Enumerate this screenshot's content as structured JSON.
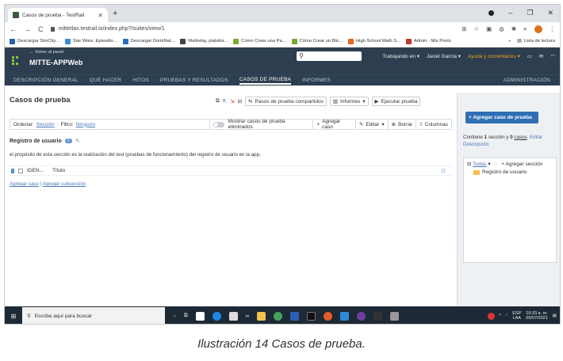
{
  "browser": {
    "tab_title": "Casos de prueba - TestRail",
    "url": "mittetlax.testrail.io/index.php?/suites/view/1",
    "bookmarks": [
      "Descargar SimCity...",
      "Star Wars. Episodio...",
      "Descargar DomiNat...",
      "Mailrelay, platafor...",
      "Cómo Crear una Pa...",
      "Cómo Crear un Blo...",
      "High School Math S...",
      "Admin - Mis Posts"
    ],
    "reading_list": "Lista de lectura"
  },
  "header": {
    "back_link": "← Volver al panel",
    "project": "MITTE-APPWeb",
    "working_on": "Trabajando en",
    "user": "Jaciel García",
    "help": "Ayuda y comentarios"
  },
  "nav": {
    "items": [
      "DESCRIPCIÓN GENERAL",
      "QUÉ HACER",
      "HITOS",
      "PRUEBAS Y RESULTADOS",
      "CASOS DE PRUEBA",
      "INFORMES"
    ],
    "admin": "ADMINISTRACIÓN"
  },
  "page": {
    "title": "Casos de prueba",
    "shared_steps": "Pasos de prueba compartidos",
    "reports": "Informes",
    "run_tests": "Ejecutar prueba"
  },
  "toolbar": {
    "sort_label": "Ordenar:",
    "sort_value": "Sección",
    "filter_label": "Filtro:",
    "filter_value": "Ninguno",
    "show_deleted": "Mostrar casos de prueba eliminados",
    "add_case": "Agregar caso",
    "edit": "Editar",
    "delete": "Borrar",
    "columns": "Columnas"
  },
  "section": {
    "name": "Registro de usuario",
    "count": "0",
    "description": "el propósito de esta sección es la realización del test (pruebas de funcionamiento) del registro de usuario en la app."
  },
  "grid": {
    "col_id": "IDEN...",
    "col_title": "Título"
  },
  "links": {
    "add_case": "Agregar caso",
    "add_subsection": "Agregar subsección"
  },
  "sidebar": {
    "add_button": "+ Agregar caso de prueba",
    "info_prefix": "Contiene",
    "info_sections": "1",
    "info_mid": "sección y",
    "info_cases": "0",
    "info_cases_word": "casos",
    "edit_description": "Editar Descripción",
    "tree_all": "Todas",
    "add_section": "Agregar sección",
    "tree_item": "Registro de usuario"
  },
  "taskbar": {
    "search_placeholder": "Escribe aquí para buscar",
    "lang": "ESP",
    "lang2": "LAA",
    "time": "10:33 a. m.",
    "date": "05/07/2021"
  },
  "caption": "Ilustración 14 Casos de prueba.",
  "colors": {
    "header": "#2c3e4f",
    "accent": "#2f6eb5",
    "help": "#f0a01e"
  }
}
